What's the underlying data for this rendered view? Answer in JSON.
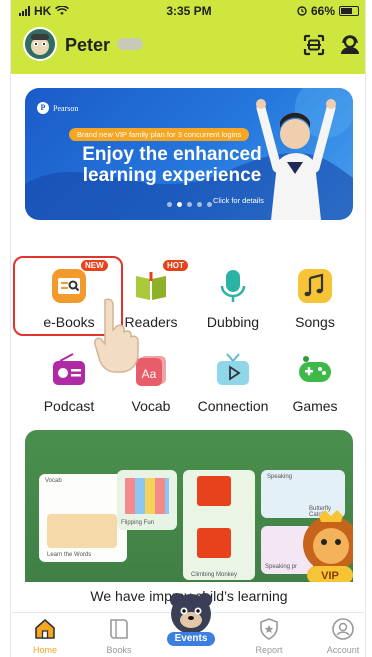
{
  "status_bar": {
    "carrier": "HK",
    "time": "3:35 PM",
    "battery": "66%"
  },
  "header": {
    "username": "Peter",
    "icons": [
      "avatar",
      "scan-icon",
      "profile-support-icon"
    ]
  },
  "banner": {
    "brand": "Pearson",
    "tag": "Brand new VIP family plan for 3 concurrent logins",
    "title": "Enjoy the enhanced learning experience",
    "link": "Click for details",
    "dots_total": 5,
    "dots_active": 2
  },
  "features": [
    {
      "label": "e-Books",
      "icon": "ebook-icon",
      "badge": "NEW"
    },
    {
      "label": "Readers",
      "icon": "readers-icon",
      "badge": "HOT"
    },
    {
      "label": "Dubbing",
      "icon": "microphone-icon",
      "badge": ""
    },
    {
      "label": "Songs",
      "icon": "music-notes-icon",
      "badge": ""
    },
    {
      "label": "Podcast",
      "icon": "radio-icon",
      "badge": ""
    },
    {
      "label": "Vocab",
      "icon": "vocab-card-icon",
      "badge": ""
    },
    {
      "label": "Connection",
      "icon": "tv-play-icon",
      "badge": ""
    },
    {
      "label": "Games",
      "icon": "gamepad-icon",
      "badge": ""
    }
  ],
  "promo": {
    "text": "We have improv    child’s learning",
    "panels": {
      "vocab": "Vocab",
      "flipping": "Flipping Fun",
      "learn_words": "Learn the Words",
      "climbing": "Climbing Monkey",
      "speaking": "Speaking",
      "butterfly": "Butterfly Catch",
      "speaking_pr": "Speaking pr",
      "vip": "VIP"
    }
  },
  "tabbar": {
    "home": "Home",
    "books": "Books",
    "events": "Events",
    "report": "Report",
    "account": "Account"
  },
  "colors": {
    "header_green": "#cfe63f",
    "accent_orange": "#f5a623",
    "highlight_red": "#e0342b",
    "banner_blue": "#2577dd"
  }
}
